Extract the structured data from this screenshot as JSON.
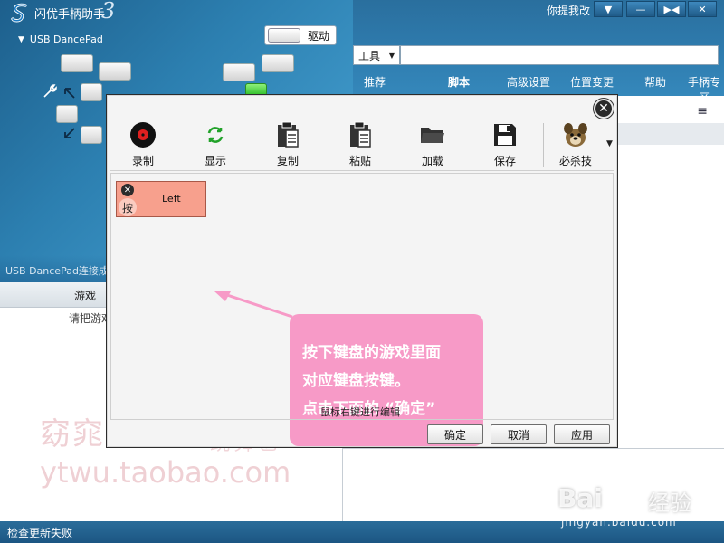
{
  "app": {
    "title": "闪优手柄助手",
    "version_mark": "3",
    "feedback_label": "你提我改",
    "window_controls": {
      "menu": "▼",
      "minimize": "—",
      "compact": "▶◀",
      "close": "✕"
    }
  },
  "device": {
    "name": "USB DancePad",
    "collapse_glyph": "▼",
    "status": "USB DancePad连接成功",
    "driver_button_label": "驱动"
  },
  "toolbar_main": {
    "dropdown_label": "工具",
    "dropdown_arrow": "▼",
    "search_value": "",
    "search_placeholder": ""
  },
  "main_tabs": [
    {
      "label": "推荐",
      "active": false
    },
    {
      "label": "脚本",
      "active": true
    },
    {
      "label": "高级设置",
      "active": false
    },
    {
      "label": "位置变更",
      "active": false
    },
    {
      "label": "帮助",
      "active": false
    },
    {
      "label": "手柄专区",
      "active": false
    }
  ],
  "left_panel": {
    "game_column_label": "游戏",
    "drag_hint": "请把游戏"
  },
  "right_panel": {
    "list_icon": "≡"
  },
  "statusbar": {
    "message": "检查更新失败"
  },
  "watermarks": {
    "shop_name": "窈窕淑女",
    "shop_sub": "跳舞毯",
    "shop_url": "ytwu.taobao.com",
    "baidu_brand": "Bai",
    "baidu_paw": "✿",
    "baidu_sub": "经验",
    "baidu_url": "jingyan.baidu.com"
  },
  "dialog": {
    "close_glyph": "✕",
    "tools": [
      {
        "label": "录制",
        "icon": "record-disc-icon"
      },
      {
        "label": "显示",
        "icon": "refresh-arrows-icon"
      },
      {
        "label": "复制",
        "icon": "clipboard-copy-icon"
      },
      {
        "label": "粘贴",
        "icon": "clipboard-paste-icon"
      },
      {
        "label": "加载",
        "icon": "folder-open-icon"
      },
      {
        "label": "保存",
        "icon": "floppy-disk-icon"
      },
      {
        "label": "必杀技",
        "icon": "dog-mascot-icon"
      }
    ],
    "more_glyph": "▼",
    "key_block": {
      "remove_glyph": "✕",
      "type_label": "按",
      "value": "Left",
      "color": "#f7a08d"
    },
    "callout": {
      "lines": [
        "按下键盘的游戏里面",
        "对应键盘按键。",
        "点击下面的 “确定”"
      ],
      "color": "#f79ac7"
    },
    "hint_text": "鼠标右键进行编辑",
    "buttons": {
      "ok": "确定",
      "cancel": "取消",
      "apply": "应用"
    }
  },
  "colors": {
    "accent_blue": "#2c7fb0",
    "status_bar": "#1c5683",
    "pad_green": "#2fbf29"
  }
}
